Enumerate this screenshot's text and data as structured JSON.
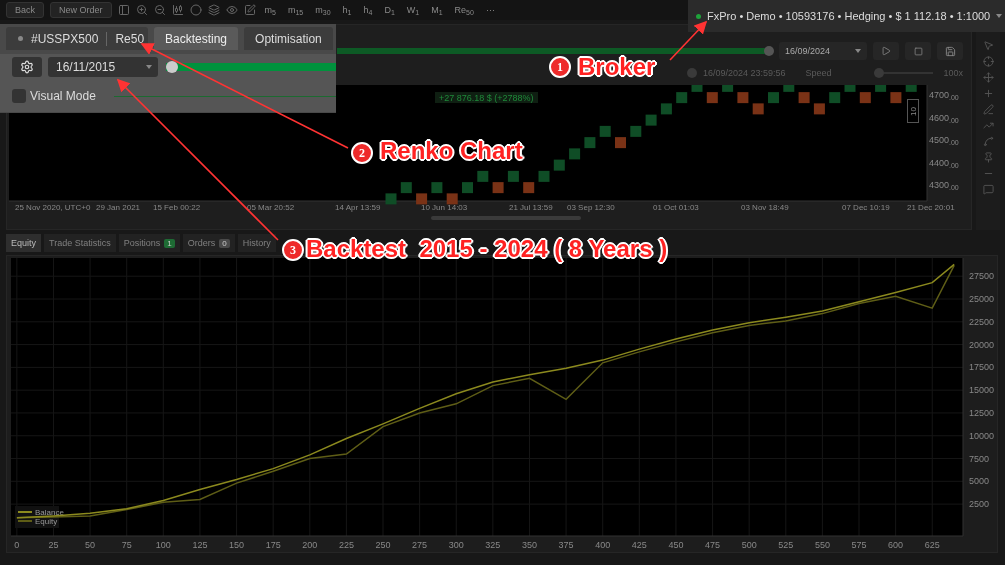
{
  "toolbar": {
    "buttons": [
      "Back",
      "New Order"
    ],
    "timeframes": [
      "m$_{5}$",
      "m$_{15}$",
      "m$_{30}$",
      "h$_{1}$",
      "h$_{4}$",
      "D$_{1}$",
      "W$_{1}$",
      "M$_{1}$",
      "Re$_{50}$"
    ],
    "more": "···"
  },
  "account": {
    "connected": true,
    "text": "FxPro • Demo • 10593176 • Hedging • $ 1 112.18 • 1:1000"
  },
  "backtest_panel": {
    "symbol": "#USSPX500",
    "timeframe": "Re50",
    "tabs": [
      {
        "label": "Backtesting",
        "selected": true
      },
      {
        "label": "Optimisation",
        "selected": false
      }
    ],
    "start_date": "16/11/2015",
    "visual_mode": {
      "label": "Visual Mode",
      "checked": false
    }
  },
  "playback": {
    "end_date": "16/09/2024",
    "current_time": "16/09/2024 23:59:56",
    "speed_label": "Speed",
    "speed": {
      "level": 0
    },
    "speed_value": "100x"
  },
  "renko": {
    "profit": "+27 876.18 $ (+2788%)",
    "brick_marker": "10",
    "price_labels": [
      "4700$_{.00}$",
      "4600$_{.00}$",
      "4500$_{.00}$",
      "4400$_{.00}$",
      "4300$_{.00}$"
    ],
    "time_labels": [
      "25 Nov 2020, UTC+0",
      "29 Jan 2021",
      "15 Feb 00:22",
      "05 Mar 20:52",
      "14 Apr 13:59",
      "10 Jun 14:03",
      "21 Jul 13:59",
      "03 Sep 12:30",
      "01 Oct 01:03",
      "03 Nov 18:49",
      "07 Dec 10:19",
      "21 Dec 20:01"
    ]
  },
  "bottom_tabs": [
    {
      "label": "Equity",
      "selected": true
    },
    {
      "label": "Trade Statistics",
      "selected": false
    },
    {
      "label": "Positions",
      "selected": false,
      "badge": "1",
      "color": "#1e6b34"
    },
    {
      "label": "Orders",
      "selected": false,
      "badge": "0",
      "color": "#4a4a4a"
    },
    {
      "label": "History",
      "selected": false
    }
  ],
  "equity": {
    "chart_data": {
      "type": "line",
      "grid": true,
      "legend": true,
      "xlim": [
        -4,
        646
      ],
      "ylim": [
        -1000,
        29500
      ],
      "x": [
        0,
        25,
        50,
        75,
        100,
        125,
        150,
        175,
        200,
        225,
        250,
        275,
        300,
        325,
        350,
        375,
        400,
        425,
        450,
        475,
        500,
        525,
        550,
        575,
        600,
        625,
        640
      ],
      "xticks": [
        0,
        25,
        50,
        75,
        100,
        125,
        150,
        175,
        200,
        225,
        250,
        275,
        300,
        325,
        350,
        375,
        400,
        425,
        450,
        475,
        500,
        525,
        550,
        575,
        600,
        625
      ],
      "yticks": [
        2500,
        5000,
        7500,
        10000,
        12500,
        15000,
        17500,
        20000,
        22500,
        25000,
        27500
      ],
      "series": [
        {
          "name": "Balance",
          "color": "#8c8a1e",
          "values": [
            1000,
            1200,
            1500,
            2000,
            2900,
            4100,
            5200,
            6400,
            7900,
            9700,
            11300,
            13000,
            14600,
            15900,
            16700,
            17400,
            18300,
            19500,
            20600,
            21600,
            22400,
            23000,
            23700,
            24700,
            25700,
            26800,
            28800
          ]
        },
        {
          "name": "Equity",
          "color": "#5e5d16",
          "values": [
            1000,
            1100,
            1200,
            1900,
            2700,
            3000,
            4800,
            6100,
            7500,
            8000,
            11000,
            12500,
            13500,
            15500,
            16300,
            14000,
            18000,
            19200,
            20300,
            21300,
            22100,
            22600,
            23400,
            24500,
            25300,
            24000,
            28700
          ]
        }
      ]
    }
  },
  "annotations": [
    {
      "number": "1",
      "label": "Broker"
    },
    {
      "number": "2",
      "label": "Renko Chart"
    },
    {
      "number": "3",
      "label": "Backtest  2015 - 2024 ( 8 Years )"
    }
  ]
}
